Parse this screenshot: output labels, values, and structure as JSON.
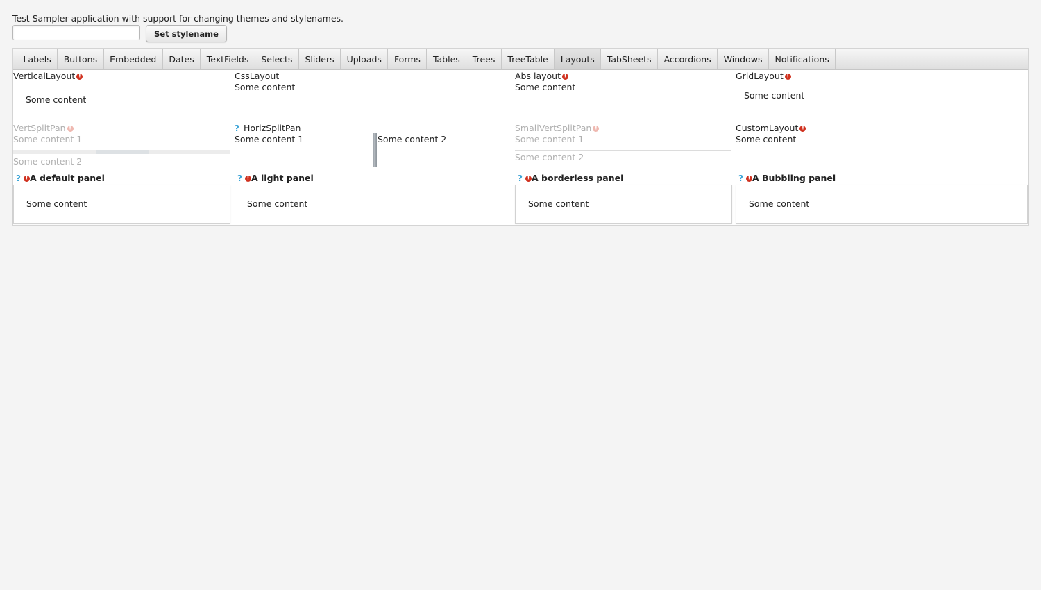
{
  "intro_text": "Test Sampler application with support for changing themes and stylenames.",
  "stylename": {
    "value": "",
    "button_label": "Set stylename"
  },
  "tabs": [
    {
      "label": "Labels"
    },
    {
      "label": "Buttons"
    },
    {
      "label": "Embedded"
    },
    {
      "label": "Dates"
    },
    {
      "label": "TextFields"
    },
    {
      "label": "Selects"
    },
    {
      "label": "Sliders"
    },
    {
      "label": "Uploads"
    },
    {
      "label": "Forms"
    },
    {
      "label": "Tables"
    },
    {
      "label": "Trees"
    },
    {
      "label": "TreeTable"
    },
    {
      "label": "Layouts"
    },
    {
      "label": "TabSheets"
    },
    {
      "label": "Accordions"
    },
    {
      "label": "Windows"
    },
    {
      "label": "Notifications"
    }
  ],
  "selected_tab": "Layouts",
  "layouts": {
    "vertical": {
      "caption": "VerticalLayout",
      "content": "Some content"
    },
    "css": {
      "caption": "CssLayout",
      "content": "Some content"
    },
    "abs": {
      "caption": "Abs layout",
      "content": "Some content"
    },
    "grid": {
      "caption": "GridLayout",
      "content": "Some content"
    },
    "vert_split": {
      "caption": "VertSplitPan",
      "first": "Some content 1",
      "second": "Some content 2"
    },
    "horiz_split": {
      "caption": "HorizSplitPan",
      "first": "Some content 1",
      "second": "Some content 2"
    },
    "small_vert_split": {
      "caption": "SmallVertSplitPan",
      "first": "Some content 1",
      "second": "Some content 2"
    },
    "custom": {
      "caption": "CustomLayout",
      "content": "Some content"
    }
  },
  "panels": {
    "default": {
      "caption": "A default panel",
      "content": "Some content"
    },
    "light": {
      "caption": "A light panel",
      "content": "Some content"
    },
    "borderless": {
      "caption": "A borderless panel",
      "content": "Some content"
    },
    "bubbling": {
      "caption": "A Bubbling panel",
      "content": "Some content"
    }
  },
  "icons": {
    "error": "!",
    "help": "?"
  },
  "colors": {
    "error": "#d0311f",
    "help": "#3aa3d6",
    "selected_tab": "#cfcfcf"
  }
}
